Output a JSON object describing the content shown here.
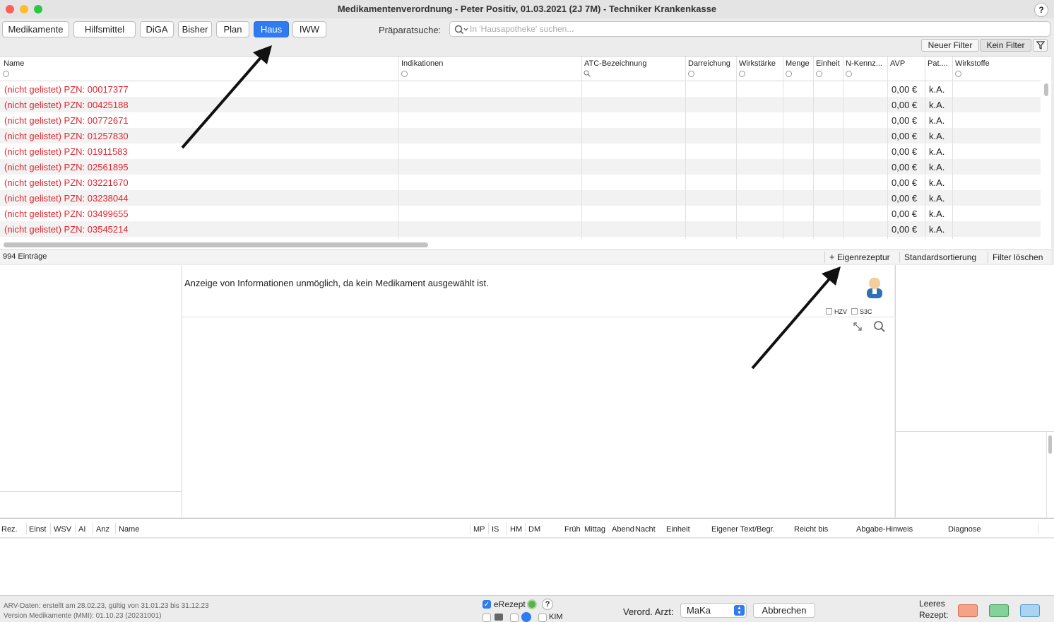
{
  "window": {
    "title": "Medikamentenverordnung - Peter Positiv, 01.03.2021 (2J 7M) - Techniker Krankenkasse",
    "help": "?"
  },
  "tabs": [
    {
      "label": "Medikamente",
      "active": false
    },
    {
      "label": "Hilfsmittel",
      "active": false
    },
    {
      "label": "DiGA",
      "active": false
    },
    {
      "label": "Bisher",
      "active": false
    },
    {
      "label": "Plan",
      "active": false
    },
    {
      "label": "Haus",
      "active": true
    },
    {
      "label": "IWW",
      "active": false
    }
  ],
  "search": {
    "label": "Präparatsuche:",
    "placeholder": "In 'Hausapotheke' suchen...",
    "value": ""
  },
  "filters": {
    "new_filter": "Neuer Filter",
    "no_filter": "Kein Filter"
  },
  "table": {
    "columns": [
      "Name",
      "Indikationen",
      "ATC-Bezeichnung",
      "Darreichung",
      "Wirkstärke",
      "Menge",
      "Einheit",
      "N-Kennz...",
      "AVP",
      "Pat....",
      "Wirkstoffe"
    ],
    "rows": [
      {
        "name": "(nicht gelistet) PZN: 00017377",
        "avp": "0,00 €",
        "pat": "k.A."
      },
      {
        "name": "(nicht gelistet) PZN: 00425188",
        "avp": "0,00 €",
        "pat": "k.A."
      },
      {
        "name": "(nicht gelistet) PZN: 00772671",
        "avp": "0,00 €",
        "pat": "k.A."
      },
      {
        "name": "(nicht gelistet) PZN: 01257830",
        "avp": "0,00 €",
        "pat": "k.A."
      },
      {
        "name": "(nicht gelistet) PZN: 01911583",
        "avp": "0,00 €",
        "pat": "k.A."
      },
      {
        "name": "(nicht gelistet) PZN: 02561895",
        "avp": "0,00 €",
        "pat": "k.A."
      },
      {
        "name": "(nicht gelistet) PZN: 03221670",
        "avp": "0,00 €",
        "pat": "k.A."
      },
      {
        "name": "(nicht gelistet) PZN: 03238044",
        "avp": "0,00 €",
        "pat": "k.A."
      },
      {
        "name": "(nicht gelistet) PZN: 03499655",
        "avp": "0,00 €",
        "pat": "k.A."
      },
      {
        "name": "(nicht gelistet) PZN: 03545214",
        "avp": "0,00 €",
        "pat": "k.A."
      }
    ],
    "entry_count": "994 Einträge",
    "buttons": {
      "eigenrezeptur": "Eigenrezeptur",
      "standardsortierung": "Standardsortierung",
      "filter_loeschen": "Filter löschen"
    }
  },
  "info": {
    "message": "Anzeige von Informationen unmöglich, da kein Medikament ausgewählt ist.",
    "hzv": "HZV",
    "s3c": "S3C"
  },
  "prescription_table": {
    "columns": [
      "Rez.",
      "Einst",
      "WSV",
      "AI",
      "Anz",
      "Name",
      "MP",
      "IS",
      "HM",
      "DM",
      "Früh",
      "Mittag",
      "Abend",
      "Nacht",
      "Einheit",
      "Eigener Text/Begr.",
      "Reicht bis",
      "Abgabe-Hinweis",
      "Diagnose"
    ]
  },
  "footer": {
    "arv_info": "ARV-Daten: erstellt am 28.02.23, gültig von 31.01.23 bis 31.12.23",
    "version_info": "Version Medikamente (MMI):  01.10.23 (20231001)",
    "erezept_label": "eRezept",
    "erezept_checked": true,
    "kim_label": "KIM",
    "help": "?",
    "verord_arzt_label": "Verord. Arzt:",
    "verord_arzt_value": "MaKa",
    "cancel": "Abbrechen",
    "leeres_rezept_line1": "Leeres",
    "leeres_rezept_line2": "Rezept:"
  },
  "colors": {
    "accent": "#2f7bf0",
    "unlisted_red": "#e0262f"
  }
}
